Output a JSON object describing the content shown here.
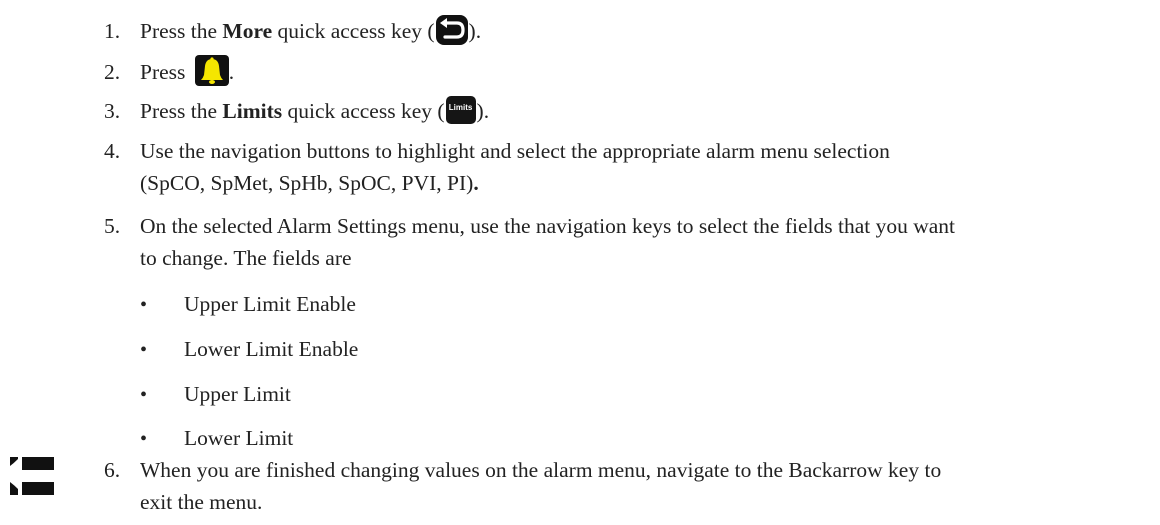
{
  "steps": [
    {
      "number": "1.",
      "pre": "Press the ",
      "bold": "More",
      "post_a": " quick access key (",
      "post_b": ")."
    },
    {
      "number": "2.",
      "pre": "Press ",
      "post": "."
    },
    {
      "number": "3.",
      "pre": "Press the ",
      "bold": "Limits",
      "post_a": " quick access key (",
      "post_b": ")."
    },
    {
      "number": "4.",
      "text": "Use the navigation buttons to highlight and select the appropriate alarm menu selection (SpCO, SpMet, SpHb, SpOC, PVI, PI)",
      "bold_period": "."
    },
    {
      "number": "5.",
      "text": "On the selected Alarm Settings menu, use the navigation keys to select the fields that you want to change. The fields are"
    },
    {
      "number": "6.",
      "text": "When you are finished changing values on the alarm menu, navigate to the Backarrow key to exit the menu."
    }
  ],
  "fields": [
    "Upper Limit Enable",
    "Lower Limit Enable",
    "Upper Limit",
    "Lower Limit"
  ],
  "bullet_char": "•",
  "icons": {
    "more_key": "back-arrow-icon",
    "alarm_key": "bell-icon",
    "limits_key": "limits-key-icon",
    "limits_key_label": "Limits",
    "margin_note": "note-icon"
  },
  "colors": {
    "text": "#222222",
    "icon_dark": "#111111",
    "bell_yellow": "#f5e600"
  }
}
